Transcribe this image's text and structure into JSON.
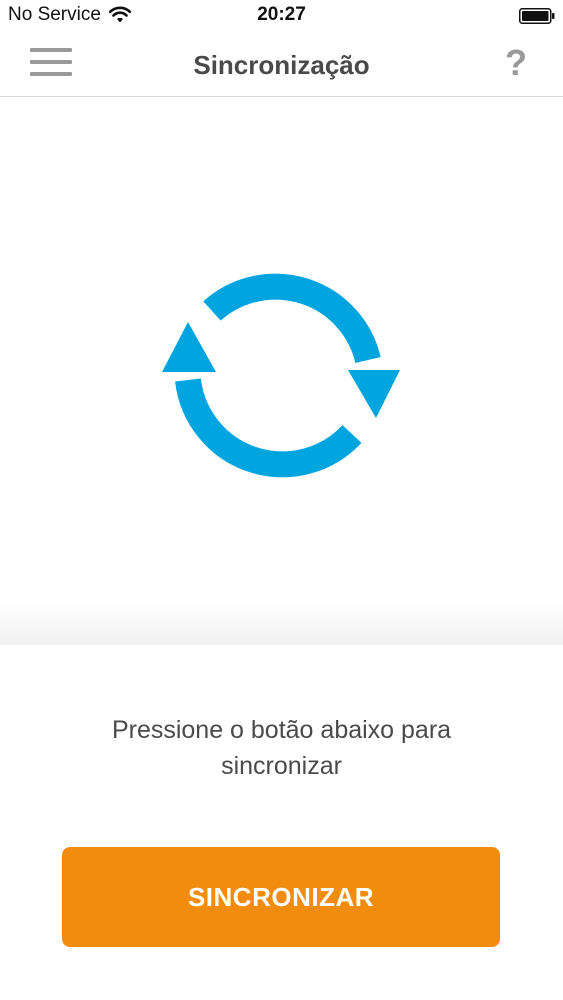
{
  "status_bar": {
    "carrier": "No Service",
    "time": "20:27",
    "wifi_icon": "wifi-icon",
    "battery_icon": "battery-icon"
  },
  "nav": {
    "title": "Sincronização",
    "menu_icon": "hamburger-menu-icon",
    "help_label": "?"
  },
  "illustration": {
    "icon": "sync-arrows-icon",
    "color": "#00a5e0"
  },
  "instruction": {
    "line1": "Pressione o botão abaixo para",
    "line2": "sincronizar"
  },
  "actions": {
    "sync_label": "SINCRONIZAR",
    "sync_color": "#f28c0f"
  }
}
